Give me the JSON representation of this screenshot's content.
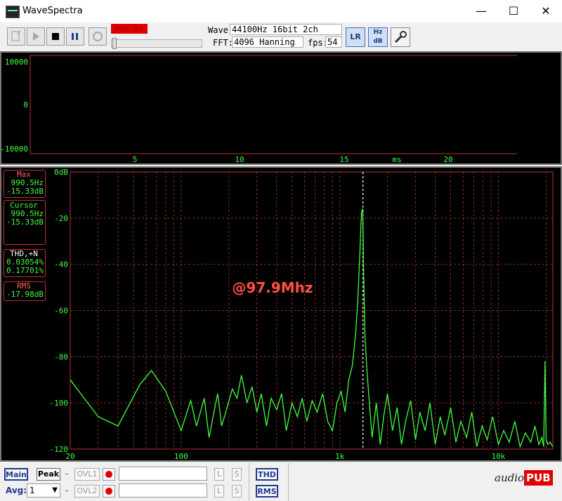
{
  "window": {
    "title": "WaveSpectra",
    "minimize": "—",
    "maximize": "☐",
    "close": "✕"
  },
  "toolbar": {
    "rec_label": "Rec.In",
    "wave_label": "Wave:",
    "wave_value": "44100Hz 16bit 2ch",
    "fft_label": "FFT:",
    "fft_value": "4096 Hanning",
    "fps_label": "fps:",
    "fps_value": "54",
    "lr_label": "LR",
    "hz_db_label": "Hz dB"
  },
  "wave_panel": {
    "y_labels": [
      "10000",
      "0",
      "-10000"
    ],
    "x_labels": [
      "5",
      "10",
      "15",
      "20"
    ],
    "x_unit": "ms"
  },
  "info": {
    "max_title": "Max",
    "max_freq": "990.5Hz",
    "max_db": "-15.33dB",
    "cursor_title": "Cursor",
    "cursor_freq": "990.5Hz",
    "cursor_db": "-15.33dB",
    "thd_title": "THD,+N",
    "thd_value": "0.03054%",
    "thdn_value": "0.17701%",
    "rms_title": "RMS",
    "rms_value": "-17.98dB"
  },
  "annotation": "@97.9Mhz",
  "chart_data": {
    "type": "line",
    "x_scale": "log",
    "xlim": [
      20,
      22050
    ],
    "ylim": [
      -120,
      0
    ],
    "x_tick_labels": [
      {
        "v": 20,
        "t": "20"
      },
      {
        "v": 100,
        "t": "100"
      },
      {
        "v": 1000,
        "t": "1k"
      },
      {
        "v": 10000,
        "t": "10k"
      }
    ],
    "y_tick_labels": [
      {
        "v": 0,
        "t": "0dB"
      },
      {
        "v": -20,
        "t": "-20"
      },
      {
        "v": -40,
        "t": "-40"
      },
      {
        "v": -60,
        "t": "-60"
      },
      {
        "v": -80,
        "t": "-80"
      },
      {
        "v": -100,
        "t": "-100"
      },
      {
        "v": -120,
        "t": "-120"
      }
    ],
    "cursor_freq": 1400,
    "line_color": "#40ff40",
    "grid_color": "#8a2a2a",
    "series": [
      {
        "x": [
          20,
          30,
          40,
          55,
          65,
          80,
          100,
          115,
          125,
          140,
          150,
          160,
          170,
          180,
          195,
          210,
          225,
          240,
          260,
          280,
          300,
          320,
          345,
          370,
          400,
          430,
          460,
          500,
          540,
          580,
          620,
          670,
          720,
          780,
          840,
          900,
          960,
          1020,
          1080,
          1140,
          1200,
          1260,
          1300,
          1340,
          1370,
          1390,
          1400,
          1415,
          1440,
          1480,
          1530,
          1600,
          1700,
          1800,
          1900,
          2000,
          2150,
          2300,
          2450,
          2600,
          2800,
          3000,
          3200,
          3450,
          3700,
          4000,
          4300,
          4600,
          5000,
          5400,
          5800,
          6300,
          6800,
          7300,
          7900,
          8500,
          9200,
          10000,
          10800,
          11700,
          12700,
          13700,
          14800,
          16000,
          17000,
          18000,
          18800,
          19300,
          19700,
          20000,
          20500,
          21200,
          22000
        ],
        "y": [
          -90,
          -106,
          -110,
          -92,
          -86,
          -95,
          -112,
          -99,
          -110,
          -98,
          -115,
          -105,
          -96,
          -110,
          -102,
          -94,
          -98,
          -88,
          -100,
          -93,
          -104,
          -96,
          -110,
          -98,
          -103,
          -96,
          -112,
          -100,
          -106,
          -98,
          -108,
          -99,
          -104,
          -96,
          -108,
          -112,
          -100,
          -95,
          -104,
          -90,
          -84,
          -70,
          -55,
          -35,
          -18,
          -16,
          -22,
          -45,
          -70,
          -85,
          -98,
          -115,
          -100,
          -118,
          -105,
          -96,
          -112,
          -102,
          -118,
          -108,
          -99,
          -116,
          -104,
          -112,
          -100,
          -118,
          -106,
          -114,
          -102,
          -117,
          -108,
          -115,
          -104,
          -119,
          -110,
          -116,
          -106,
          -118,
          -112,
          -117,
          -108,
          -119,
          -113,
          -117,
          -110,
          -118,
          -115,
          -119,
          -82,
          -116,
          -118,
          -117,
          -119
        ]
      }
    ]
  },
  "bottom": {
    "main": "Main",
    "peak": "Peak",
    "dash1": "-",
    "ovl1": "OVL1",
    "l1": "L",
    "s1": "S",
    "avg_label": "Avg:",
    "avg_value": "1",
    "dash2": "-",
    "ovl2": "OVL2",
    "l2": "L",
    "s2": "S",
    "thd": "THD",
    "rms": "RMS",
    "logo_audio": "audio",
    "logo_pub": "PUB"
  }
}
